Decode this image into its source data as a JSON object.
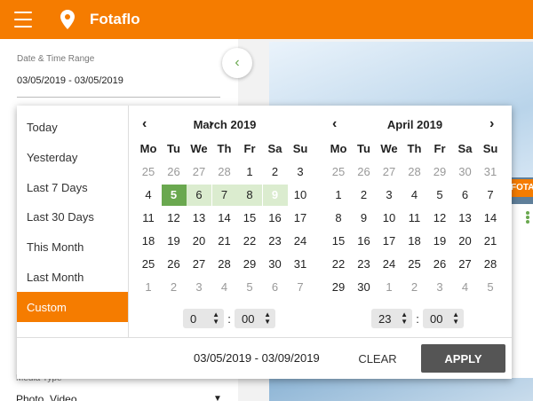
{
  "app": {
    "title": "Fotaflo",
    "brand_tag": "FOTAFLO"
  },
  "filters": {
    "date_label": "Date & Time Range",
    "date_value": "03/05/2019 - 03/05/2019",
    "media_label": "Media Type",
    "media_value": "Photo, Video"
  },
  "presets": [
    "Today",
    "Yesterday",
    "Last 7 Days",
    "Last 30 Days",
    "This Month",
    "Last Month",
    "Custom"
  ],
  "active_preset": "Custom",
  "weekdays": [
    "Mo",
    "Tu",
    "We",
    "Th",
    "Fr",
    "Sa",
    "Su"
  ],
  "calendars": [
    {
      "title": "March 2019",
      "weeks": [
        [
          "25",
          "26",
          "27",
          "28",
          "1",
          "2",
          "3"
        ],
        [
          "4",
          "5",
          "6",
          "7",
          "8",
          "9",
          "10"
        ],
        [
          "11",
          "12",
          "13",
          "14",
          "15",
          "16",
          "17"
        ],
        [
          "18",
          "19",
          "20",
          "21",
          "22",
          "23",
          "24"
        ],
        [
          "25",
          "26",
          "27",
          "28",
          "29",
          "30",
          "31"
        ],
        [
          "1",
          "2",
          "3",
          "4",
          "5",
          "6",
          "7"
        ]
      ]
    },
    {
      "title": "April 2019",
      "weeks": [
        [
          "25",
          "26",
          "27",
          "28",
          "29",
          "30",
          "31"
        ],
        [
          "1",
          "2",
          "3",
          "4",
          "5",
          "6",
          "7"
        ],
        [
          "8",
          "9",
          "10",
          "11",
          "12",
          "13",
          "14"
        ],
        [
          "15",
          "16",
          "17",
          "18",
          "19",
          "20",
          "21"
        ],
        [
          "22",
          "23",
          "24",
          "25",
          "26",
          "27",
          "28"
        ],
        [
          "29",
          "30",
          "1",
          "2",
          "3",
          "4",
          "5"
        ]
      ]
    }
  ],
  "selection": {
    "start_day": "5",
    "end_day": "9"
  },
  "times": [
    {
      "hour": "0",
      "minute": "00"
    },
    {
      "hour": "23",
      "minute": "00"
    }
  ],
  "range_text": "03/05/2019 - 03/09/2019",
  "buttons": {
    "clear": "CLEAR",
    "apply": "APPLY"
  },
  "colors": {
    "accent": "#f57c00",
    "selection": "#6aa84f",
    "range": "#dbeccf",
    "apply": "#555555"
  }
}
